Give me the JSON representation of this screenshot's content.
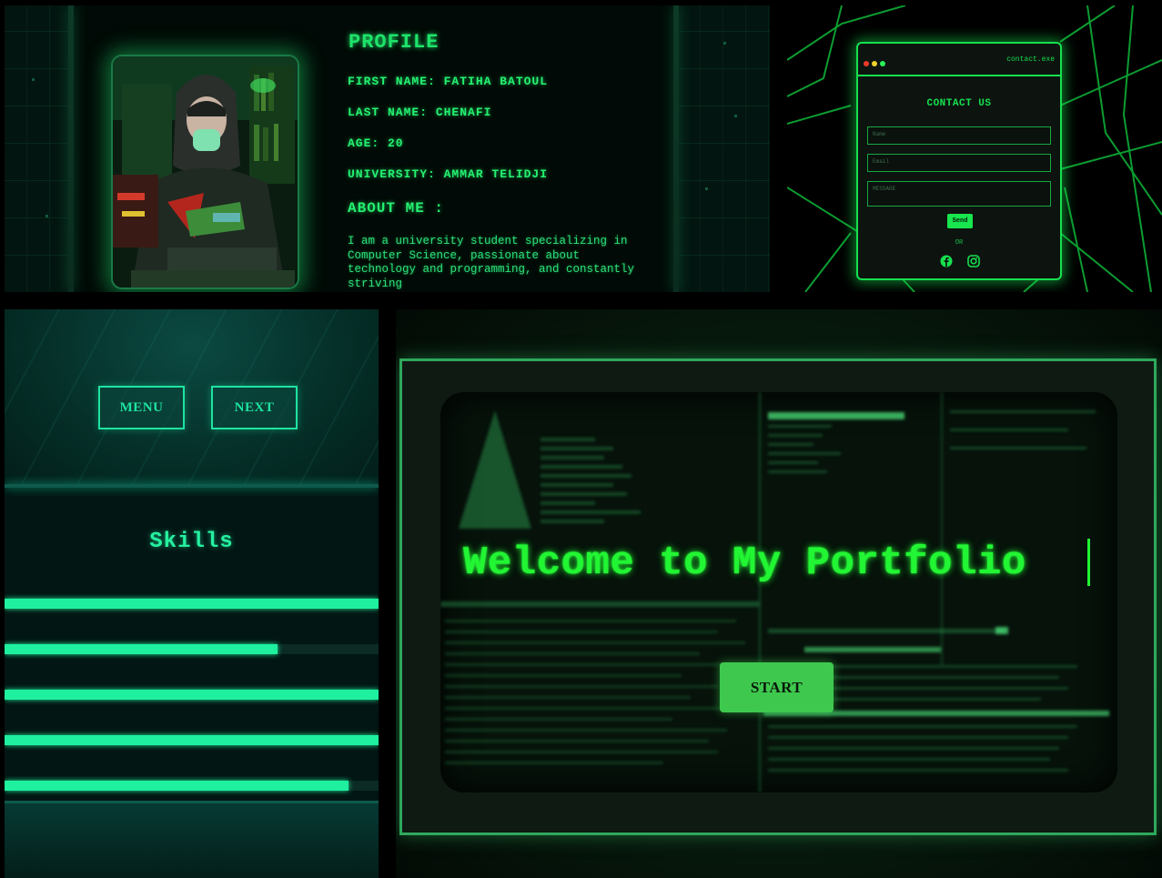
{
  "profile": {
    "title": "PROFILE",
    "first_name": "FIRST NAME: FATIHA BATOUL",
    "last_name": "LAST NAME: CHENAFI",
    "age": "AGE: 20",
    "university": "UNIVERSITY: AMMAR TELIDJI",
    "about_title": "ABOUT ME :",
    "about_text": "I am a university student specializing in Computer Science, passionate about technology and programming, and constantly striving"
  },
  "contact": {
    "window_label": "contact.exe",
    "title": "CONTACT US",
    "name_placeholder": "Name",
    "email_placeholder": "Email",
    "message_placeholder": "MESSAGE",
    "send_label": "Send",
    "or_label": "OR",
    "social_icons": [
      "facebook-icon",
      "instagram-icon"
    ]
  },
  "nav": {
    "menu_label": "MENU",
    "next_label": "NEXT"
  },
  "skills": {
    "title": "Skills",
    "levels": [
      1.0,
      0.73,
      1.0,
      1.0,
      0.92
    ]
  },
  "welcome": {
    "title": "Welcome to My Portfolio",
    "start_label": "START"
  },
  "colors": {
    "profile_green": "#1ee36a",
    "contact_green": "#16e04e",
    "skills_teal": "#1ef0a0",
    "welcome_green": "#22f533",
    "start_button": "#3ec94e"
  }
}
